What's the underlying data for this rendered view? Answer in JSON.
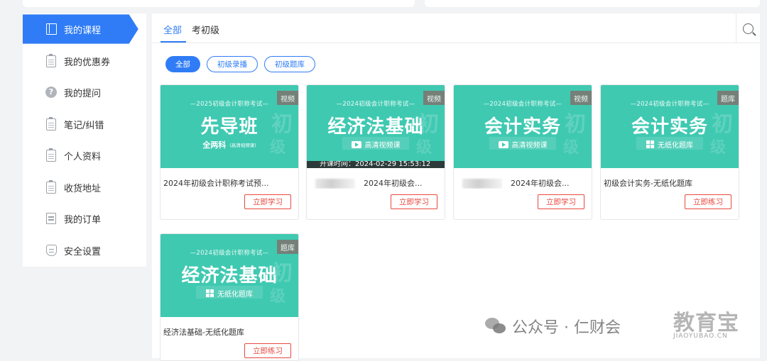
{
  "sidebar": {
    "items": [
      {
        "label": "我的课程",
        "icon": "book-icon",
        "active": true
      },
      {
        "label": "我的优惠券",
        "icon": "coupon-icon"
      },
      {
        "label": "我的提问",
        "icon": "question-icon"
      },
      {
        "label": "笔记/纠错",
        "icon": "notes-icon"
      },
      {
        "label": "个人资料",
        "icon": "profile-icon"
      },
      {
        "label": "收货地址",
        "icon": "address-icon"
      },
      {
        "label": "我的订单",
        "icon": "order-icon"
      },
      {
        "label": "安全设置",
        "icon": "shield-icon"
      }
    ],
    "active_color": "#2f7cf6"
  },
  "tabs": [
    {
      "label": "全部",
      "active": true
    },
    {
      "label": "考初级"
    }
  ],
  "filters": [
    {
      "label": "全部",
      "active": true
    },
    {
      "label": "初级录播"
    },
    {
      "label": "初级题库"
    }
  ],
  "cards": [
    {
      "tag": "视频",
      "header": "—2025初级会计职称考试—",
      "big": "先导班",
      "sub": "全两科",
      "sub_small": "(高清视频课)",
      "title": "2024年初级会计职称考试预...",
      "button": "立即学习"
    },
    {
      "tag": "视频",
      "header": "—2024初级会计职称考试—",
      "big": "经济法基础",
      "sub": "高清视频课",
      "time": "开课时间：2024-02-29 15:53:12",
      "title": "2024年初级会...",
      "button": "立即学习"
    },
    {
      "tag": "视频",
      "header": "—2024初级会计职称考试—",
      "big": "会计实务",
      "sub": "高清视频课",
      "title": "2024年初级会...",
      "button": "立即学习"
    },
    {
      "tag": "题库",
      "header": "—2024初级会计职称考试—",
      "big": "会计实务",
      "sub": "无纸化题库",
      "title": "初级会计实务-无纸化题库",
      "button": "立即练习"
    },
    {
      "tag": "题库",
      "header": "—2024初级会计职称考试—",
      "big": "经济法基础",
      "sub": "无纸化题库",
      "title": "经济法基础-无纸化题库",
      "button": "立即练习"
    }
  ],
  "thumb_watermark": [
    "初",
    "级"
  ],
  "watermark": {
    "text": "公众号 · 仁财会",
    "brand": "教育宝",
    "brand_sub": "JIAOYUBAO.CN"
  }
}
